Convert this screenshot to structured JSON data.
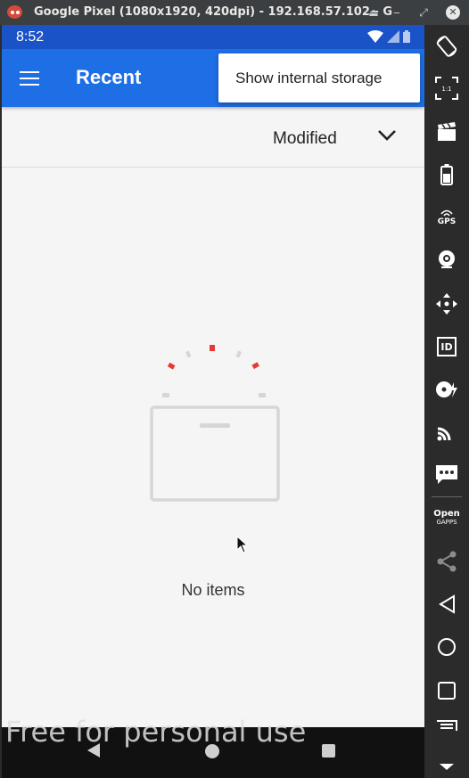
{
  "window": {
    "title": "Google Pixel (1080x1920, 420dpi) - 192.168.57.102 - G",
    "buttons": [
      "up-arrow",
      "minimize",
      "restore",
      "close"
    ]
  },
  "statusbar": {
    "time": "8:52"
  },
  "appbar": {
    "title": "Recent"
  },
  "overflow_menu": {
    "item": "Show internal storage"
  },
  "sortbar": {
    "label": "Modified"
  },
  "empty_state": {
    "text": "No items"
  },
  "watermark": {
    "text": "Free for personal use"
  },
  "sidebar": {
    "items": [
      "rotate-icon",
      "one-to-one-icon",
      "screenrecord-icon",
      "battery-icon",
      "gps-icon",
      "camera-icon",
      "move-icon",
      "id-icon",
      "media-icon",
      "cast-icon",
      "sms-icon",
      "opengapps-icon",
      "share-icon",
      "back-icon",
      "home-icon",
      "recents-icon",
      "menu-icon",
      "expand-icon"
    ],
    "gps_label": "GPS",
    "id_label": "ID",
    "opengapps_label_1": "Open",
    "opengapps_label_2": "GAPPS"
  }
}
